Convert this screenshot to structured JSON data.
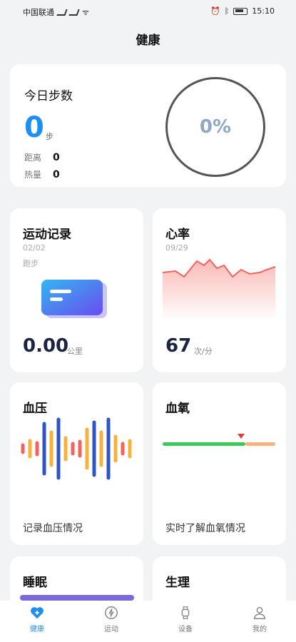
{
  "status_bar": {
    "carrier": "中国联通",
    "time": "15:10"
  },
  "header": {
    "title": "健康"
  },
  "steps": {
    "label": "今日步数",
    "value": "0",
    "unit": "步",
    "distance_label": "距离",
    "distance_value": "0",
    "calories_label": "热量",
    "calories_value": "0",
    "percent": "0%"
  },
  "exercise": {
    "title": "运动记录",
    "date": "02/02",
    "type": "跑步",
    "value": "0.00",
    "unit": "公里"
  },
  "heart_rate": {
    "title": "心率",
    "date": "09/29",
    "value": "67",
    "unit": "次/分"
  },
  "blood_pressure": {
    "title": "血压",
    "desc": "记录血压情况"
  },
  "blood_oxygen": {
    "title": "血氧",
    "desc": "实时了解血氧情况"
  },
  "sleep": {
    "title": "睡眠"
  },
  "period": {
    "title": "生理"
  },
  "tabs": [
    {
      "label": "健康",
      "icon": "heart-icon",
      "active": true
    },
    {
      "label": "运动",
      "icon": "lightning-icon",
      "active": false
    },
    {
      "label": "设备",
      "icon": "watch-icon",
      "active": false
    },
    {
      "label": "我的",
      "icon": "person-icon",
      "active": false
    }
  ],
  "colors": {
    "accent": "#1d8ff0",
    "heart_line": "#f2645c",
    "o2_green": "#3cc85a",
    "o2_orange": "#f6b27a"
  }
}
